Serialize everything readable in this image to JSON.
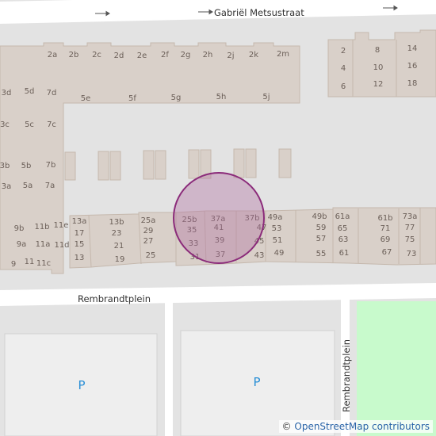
{
  "map": {
    "streets": {
      "top": "Gabriël Metsustraat",
      "middle": "Rembrandtplein",
      "vertical": "Rembrandtplein"
    },
    "parking_label": "P",
    "house_numbers": {
      "row_2": [
        "2a",
        "2b",
        "2c",
        "2d",
        "2e",
        "2f",
        "2g",
        "2h",
        "2j",
        "2k",
        "2m"
      ],
      "row_5": [
        "5e",
        "5f",
        "5g",
        "5h",
        "5j"
      ],
      "left_block": [
        "3d",
        "5d",
        "7d",
        "3c",
        "5c",
        "7c",
        "3b",
        "5b",
        "7b",
        "3a",
        "5a",
        "7a"
      ],
      "top_right": [
        "2",
        "8",
        "14",
        "4",
        "10",
        "16",
        "6",
        "12",
        "18"
      ],
      "left_lower": [
        "9b",
        "11b",
        "11e",
        "9a",
        "11a",
        "11d",
        "9",
        "11",
        "11c"
      ],
      "south_row": [
        "13a",
        "13b",
        "25a",
        "25b",
        "37a",
        "37b",
        "49a",
        "49b",
        "61a",
        "61b",
        "73a",
        "17",
        "23",
        "29",
        "35",
        "41",
        "47",
        "53",
        "59",
        "65",
        "71",
        "77",
        "15",
        "21",
        "27",
        "33",
        "39",
        "45",
        "51",
        "57",
        "63",
        "69",
        "75",
        "13",
        "19",
        "25",
        "31",
        "37",
        "43",
        "49",
        "55",
        "61",
        "67",
        "73"
      ]
    },
    "colors": {
      "background": "#e3e3e3",
      "road": "#ffffff",
      "building": "#d9d0c9",
      "building_stroke": "#c5b8ad",
      "parking": "#eeeeee",
      "park": "#c8facc",
      "marker_fill": "#b06fa0",
      "marker_stroke": "#8b2b7a"
    }
  },
  "attribution": {
    "symbol": "©",
    "text": "OpenStreetMap contributors"
  }
}
